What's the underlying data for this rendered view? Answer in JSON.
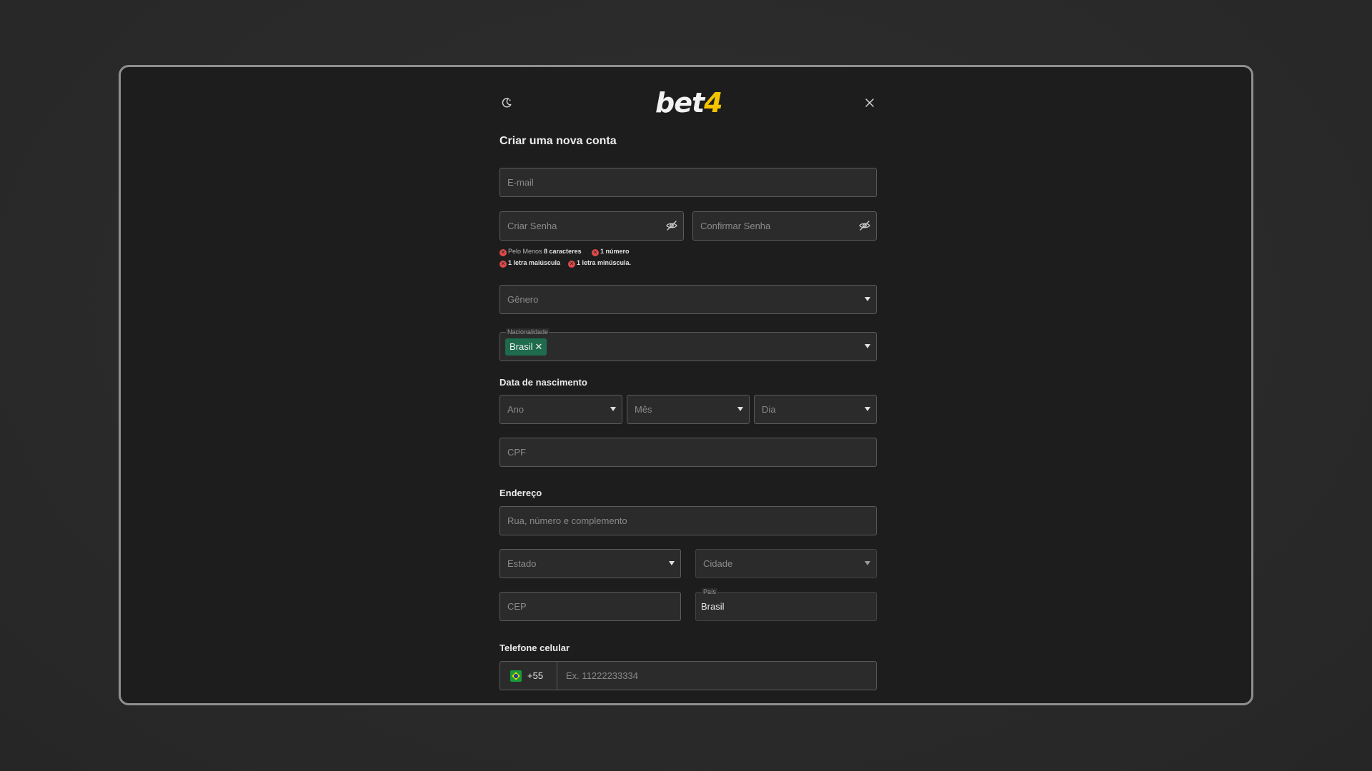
{
  "header": {
    "logo_text": "bet",
    "logo_number": "4",
    "theme_icon": "moon-icon",
    "close_icon": "close-icon"
  },
  "form": {
    "title": "Criar uma nova conta",
    "email_placeholder": "E-mail",
    "password_placeholder": "Criar Senha",
    "confirm_password_placeholder": "Confirmar Senha",
    "password_rules": [
      {
        "prefix": "Pelo Menos ",
        "emphasis": "8 caracteres"
      },
      {
        "prefix": "",
        "emphasis": "1 número"
      },
      {
        "prefix": "",
        "emphasis": "1 letra maiúscula"
      },
      {
        "prefix": "",
        "emphasis": "1 letra minúscula."
      }
    ],
    "gender_placeholder": "Gênero",
    "nationality": {
      "label": "Nacionalidade",
      "selected": "Brasil",
      "remove_glyph": "✕"
    },
    "birth": {
      "label": "Data de nascimento",
      "year_placeholder": "Ano",
      "month_placeholder": "Mês",
      "day_placeholder": "Dia"
    },
    "cpf_placeholder": "CPF",
    "address": {
      "label": "Endereço",
      "street_placeholder": "Rua, número e complemento",
      "state_placeholder": "Estado",
      "city_placeholder": "Cidade",
      "zip_placeholder": "CEP",
      "country_label": "País",
      "country_value": "Brasil"
    },
    "phone": {
      "label": "Telefone celular",
      "country_code": "+55",
      "placeholder": "Ex. 11222233334"
    }
  },
  "colors": {
    "accent_logo": "#f5c400",
    "chip_bg": "#1e6b4e",
    "error": "#e04a4a",
    "field_bg": "#2b2b2b"
  }
}
